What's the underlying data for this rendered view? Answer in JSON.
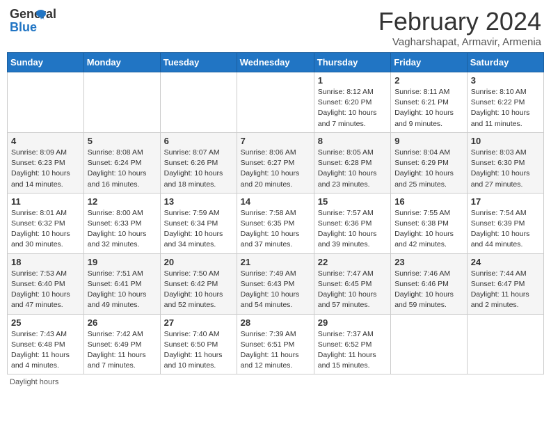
{
  "header": {
    "logo_general": "General",
    "logo_blue": "Blue",
    "month_title": "February 2024",
    "subtitle": "Vagharshapat, Armavir, Armenia"
  },
  "days_of_week": [
    "Sunday",
    "Monday",
    "Tuesday",
    "Wednesday",
    "Thursday",
    "Friday",
    "Saturday"
  ],
  "footer": {
    "daylight_hours": "Daylight hours"
  },
  "weeks": [
    [
      {
        "day": "",
        "info": ""
      },
      {
        "day": "",
        "info": ""
      },
      {
        "day": "",
        "info": ""
      },
      {
        "day": "",
        "info": ""
      },
      {
        "day": "1",
        "info": "Sunrise: 8:12 AM\nSunset: 6:20 PM\nDaylight: 10 hours and 7 minutes."
      },
      {
        "day": "2",
        "info": "Sunrise: 8:11 AM\nSunset: 6:21 PM\nDaylight: 10 hours and 9 minutes."
      },
      {
        "day": "3",
        "info": "Sunrise: 8:10 AM\nSunset: 6:22 PM\nDaylight: 10 hours and 11 minutes."
      }
    ],
    [
      {
        "day": "4",
        "info": "Sunrise: 8:09 AM\nSunset: 6:23 PM\nDaylight: 10 hours and 14 minutes."
      },
      {
        "day": "5",
        "info": "Sunrise: 8:08 AM\nSunset: 6:24 PM\nDaylight: 10 hours and 16 minutes."
      },
      {
        "day": "6",
        "info": "Sunrise: 8:07 AM\nSunset: 6:26 PM\nDaylight: 10 hours and 18 minutes."
      },
      {
        "day": "7",
        "info": "Sunrise: 8:06 AM\nSunset: 6:27 PM\nDaylight: 10 hours and 20 minutes."
      },
      {
        "day": "8",
        "info": "Sunrise: 8:05 AM\nSunset: 6:28 PM\nDaylight: 10 hours and 23 minutes."
      },
      {
        "day": "9",
        "info": "Sunrise: 8:04 AM\nSunset: 6:29 PM\nDaylight: 10 hours and 25 minutes."
      },
      {
        "day": "10",
        "info": "Sunrise: 8:03 AM\nSunset: 6:30 PM\nDaylight: 10 hours and 27 minutes."
      }
    ],
    [
      {
        "day": "11",
        "info": "Sunrise: 8:01 AM\nSunset: 6:32 PM\nDaylight: 10 hours and 30 minutes."
      },
      {
        "day": "12",
        "info": "Sunrise: 8:00 AM\nSunset: 6:33 PM\nDaylight: 10 hours and 32 minutes."
      },
      {
        "day": "13",
        "info": "Sunrise: 7:59 AM\nSunset: 6:34 PM\nDaylight: 10 hours and 34 minutes."
      },
      {
        "day": "14",
        "info": "Sunrise: 7:58 AM\nSunset: 6:35 PM\nDaylight: 10 hours and 37 minutes."
      },
      {
        "day": "15",
        "info": "Sunrise: 7:57 AM\nSunset: 6:36 PM\nDaylight: 10 hours and 39 minutes."
      },
      {
        "day": "16",
        "info": "Sunrise: 7:55 AM\nSunset: 6:38 PM\nDaylight: 10 hours and 42 minutes."
      },
      {
        "day": "17",
        "info": "Sunrise: 7:54 AM\nSunset: 6:39 PM\nDaylight: 10 hours and 44 minutes."
      }
    ],
    [
      {
        "day": "18",
        "info": "Sunrise: 7:53 AM\nSunset: 6:40 PM\nDaylight: 10 hours and 47 minutes."
      },
      {
        "day": "19",
        "info": "Sunrise: 7:51 AM\nSunset: 6:41 PM\nDaylight: 10 hours and 49 minutes."
      },
      {
        "day": "20",
        "info": "Sunrise: 7:50 AM\nSunset: 6:42 PM\nDaylight: 10 hours and 52 minutes."
      },
      {
        "day": "21",
        "info": "Sunrise: 7:49 AM\nSunset: 6:43 PM\nDaylight: 10 hours and 54 minutes."
      },
      {
        "day": "22",
        "info": "Sunrise: 7:47 AM\nSunset: 6:45 PM\nDaylight: 10 hours and 57 minutes."
      },
      {
        "day": "23",
        "info": "Sunrise: 7:46 AM\nSunset: 6:46 PM\nDaylight: 10 hours and 59 minutes."
      },
      {
        "day": "24",
        "info": "Sunrise: 7:44 AM\nSunset: 6:47 PM\nDaylight: 11 hours and 2 minutes."
      }
    ],
    [
      {
        "day": "25",
        "info": "Sunrise: 7:43 AM\nSunset: 6:48 PM\nDaylight: 11 hours and 4 minutes."
      },
      {
        "day": "26",
        "info": "Sunrise: 7:42 AM\nSunset: 6:49 PM\nDaylight: 11 hours and 7 minutes."
      },
      {
        "day": "27",
        "info": "Sunrise: 7:40 AM\nSunset: 6:50 PM\nDaylight: 11 hours and 10 minutes."
      },
      {
        "day": "28",
        "info": "Sunrise: 7:39 AM\nSunset: 6:51 PM\nDaylight: 11 hours and 12 minutes."
      },
      {
        "day": "29",
        "info": "Sunrise: 7:37 AM\nSunset: 6:52 PM\nDaylight: 11 hours and 15 minutes."
      },
      {
        "day": "",
        "info": ""
      },
      {
        "day": "",
        "info": ""
      }
    ]
  ]
}
